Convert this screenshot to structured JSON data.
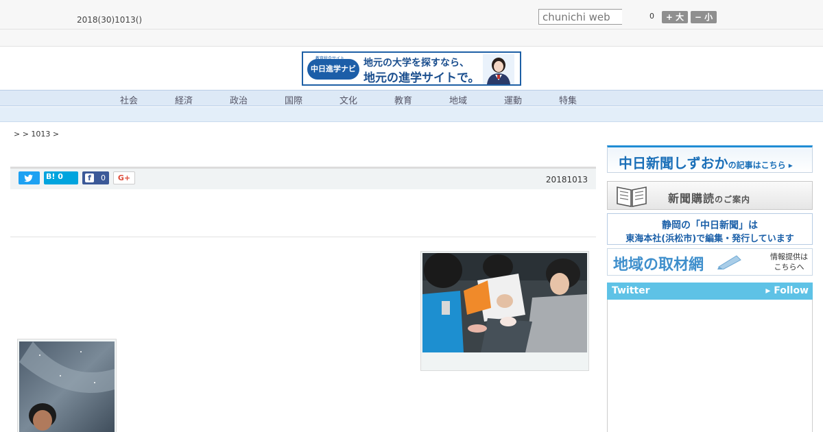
{
  "header": {
    "date": "2018(30)1013()",
    "search_placeholder": "chunichi web",
    "font_size_value": "0",
    "size_up_label": "+ 大",
    "size_down_label": "− 小"
  },
  "banner": {
    "logo_text": "中日進学ナビ",
    "logo_small": "教育総合サイト",
    "line1": "地元の大学を探すなら、",
    "line2": "地元の進学サイトで。"
  },
  "nav": {
    "items": [
      "社会",
      "経済",
      "政治",
      "国際",
      "文化",
      "教育",
      "地域",
      "運動",
      "特集"
    ]
  },
  "breadcrumb": ">  > 1013 >",
  "article": {
    "share": {
      "hatena_label": "B! 0",
      "facebook_count": "0",
      "gplus_label": "G+"
    },
    "date": "20181013"
  },
  "sidebar": {
    "banner1_main": "中日新聞しずおか",
    "banner1_sub": "の記事はこちら ▸",
    "banner2_main": "新聞購読",
    "banner2_sub": "のご案内",
    "banner3_line1": "静岡の「中日新聞」は",
    "banner3_line2": "東海本社(浜松市)で編集・発行しています",
    "banner4_main": "地域の取材網",
    "banner4_sub_line1": "情報提供は",
    "banner4_sub_line2": "こちらへ",
    "twitter_title": "Twitter",
    "twitter_follow": "▸ Follow"
  },
  "colors": {
    "accent": "#1f8cd4",
    "nav_bg": "#dde9f6",
    "twitter": "#5ec2e6"
  }
}
